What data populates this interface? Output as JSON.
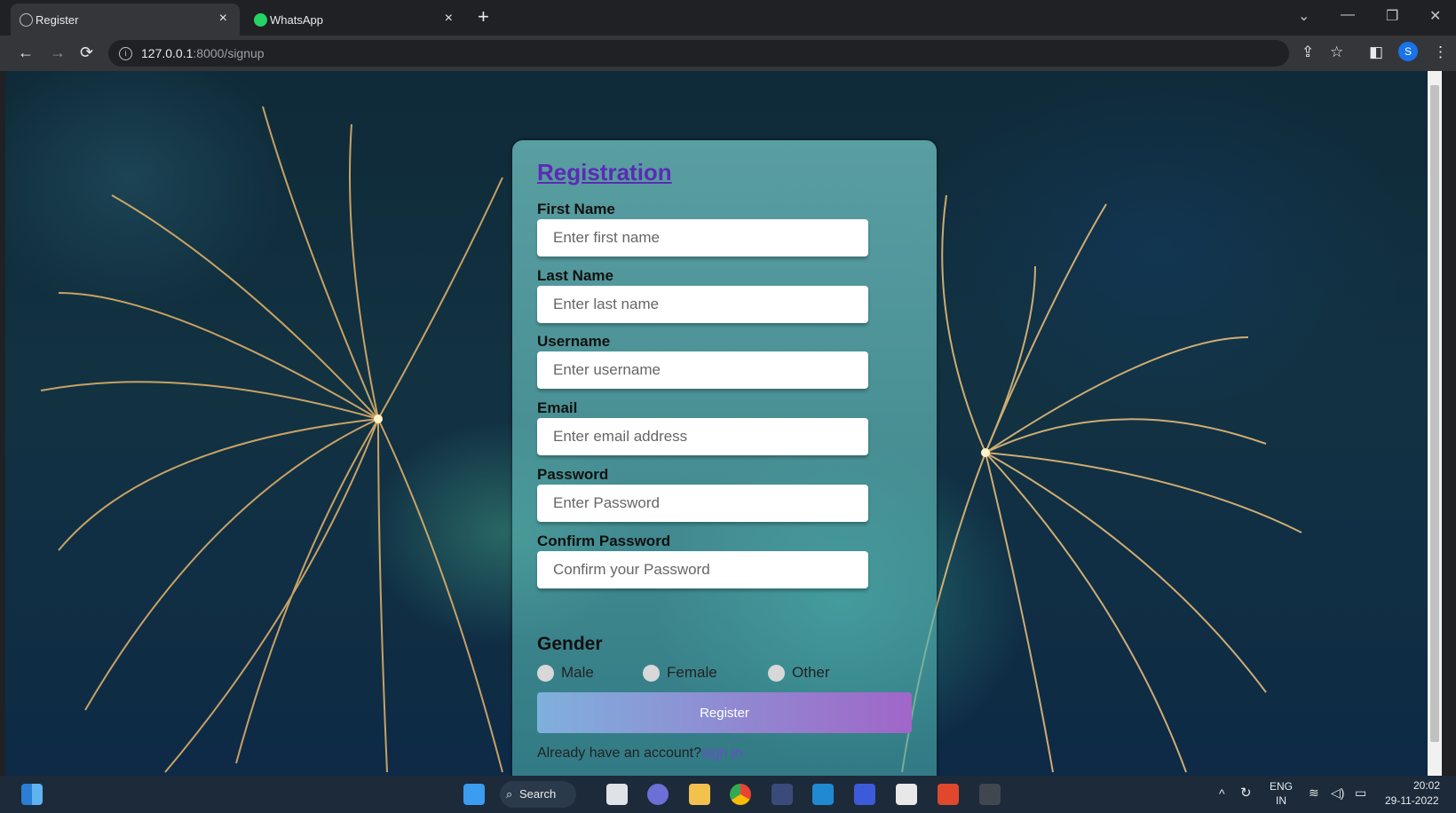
{
  "browser": {
    "tabs": [
      {
        "label": "Register",
        "active": true,
        "icon": "globe-icon"
      },
      {
        "label": "WhatsApp",
        "active": false,
        "icon": "whatsapp-icon"
      }
    ],
    "new_tab": "+",
    "close": "×",
    "url_host": "127.0.0.1",
    "url_path": ":8000/signup",
    "profile_initial": "S"
  },
  "form": {
    "title": "Registration",
    "fields": [
      {
        "label": "First Name",
        "placeholder": "Enter first name"
      },
      {
        "label": "Last Name",
        "placeholder": "Enter last name"
      },
      {
        "label": "Username",
        "placeholder": "Enter username"
      },
      {
        "label": "Email",
        "placeholder": "Enter email address"
      },
      {
        "label": "Password",
        "placeholder": "Enter Password"
      },
      {
        "label": "Confirm Password",
        "placeholder": "Confirm your Password"
      }
    ],
    "gender_title": "Gender",
    "gender_options": [
      "Male",
      "Female",
      "Other"
    ],
    "submit_label": "Register",
    "signin_prompt": "Already have an account?",
    "signin_link": "sign in"
  },
  "taskbar": {
    "search_label": "Search",
    "lang_top": "ENG",
    "lang_bottom": "IN",
    "time": "20:02",
    "date": "29-11-2022"
  },
  "colors": {
    "title": "#5b2bb5",
    "link": "#6d4acf",
    "button_start": "#7fb0dc",
    "button_end": "#a066c8",
    "profile": "#1a73e8"
  }
}
